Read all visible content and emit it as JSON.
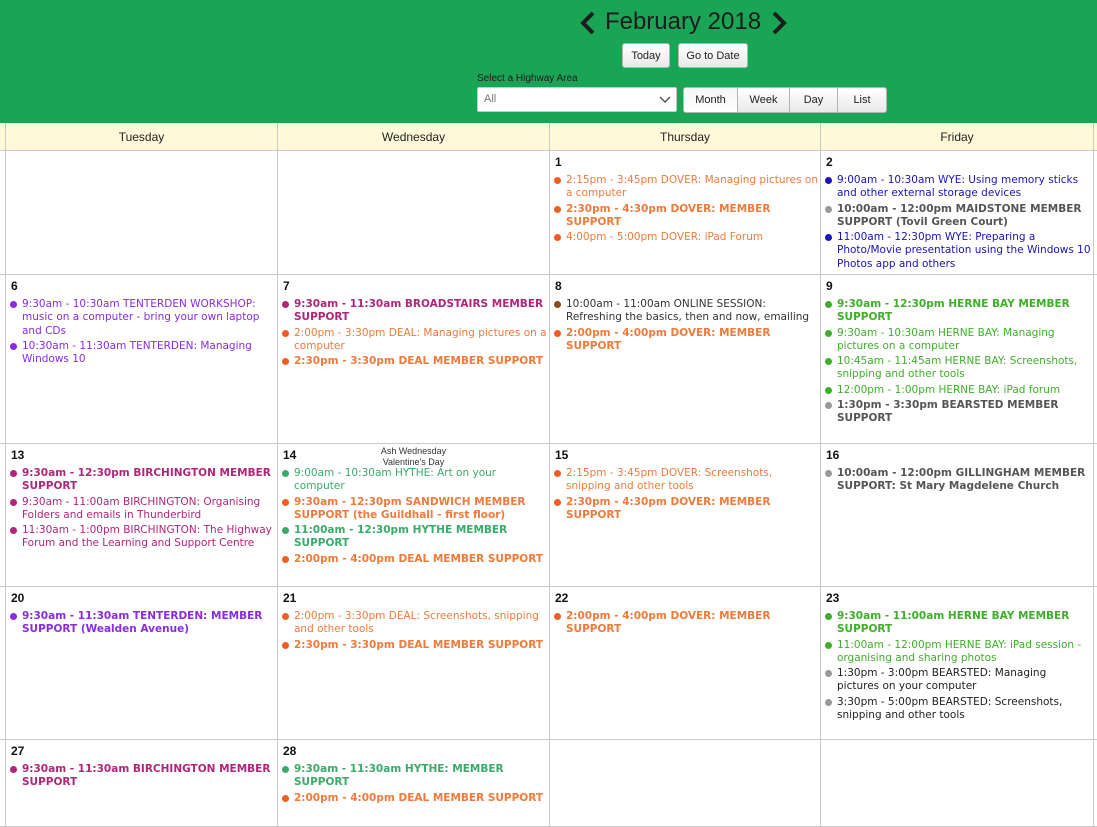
{
  "header": {
    "month_title": "February 2018",
    "today_label": "Today",
    "goto_label": "Go to Date",
    "area_label": "Select a Highway Area",
    "area_value": "All",
    "views": [
      "Month",
      "Week",
      "Day",
      "List"
    ],
    "active_view": "Month"
  },
  "colors": {
    "topbar": "#1aa556",
    "header_row": "#fff9d9",
    "dover": "#ef5d20",
    "wye": "#1a13b8",
    "maidstone": "#999999",
    "tenterden": "#8a2be2",
    "broadstairs": "#b0257a",
    "deal": "#ef5d20",
    "herne_bay": "#3fae2a",
    "bearsted": "#999999",
    "online": "#8a4a1a",
    "hythe": "#3aaa6a",
    "gillingham": "#999999"
  },
  "calendar": {
    "weekdays": [
      "Tuesday",
      "Wednesday",
      "Thursday",
      "Friday"
    ],
    "weeks": [
      {
        "days": [
          {
            "date": "",
            "events": []
          },
          {
            "date": "",
            "events": []
          },
          {
            "date": "1",
            "events": [
              {
                "time": "2:15pm - 3:45pm",
                "text": "DOVER: Managing pictures on a computer",
                "color": "#ef5d20",
                "text_color": "#ef7a3a",
                "bold": false
              },
              {
                "time": "2:30pm - 4:30pm",
                "text": "DOVER: MEMBER SUPPORT",
                "color": "#ef5d20",
                "text_color": "#ef7a3a",
                "bold": true
              },
              {
                "time": "4:00pm - 5:00pm",
                "text": "DOVER: iPad Forum",
                "color": "#ef5d20",
                "text_color": "#ef7a3a",
                "bold": false
              }
            ]
          },
          {
            "date": "2",
            "events": [
              {
                "time": "9:00am - 10:30am",
                "text": "WYE: Using memory sticks and other external storage devices",
                "color": "#1a13b8",
                "text_color": "#1a13b8",
                "bold": false
              },
              {
                "time": "10:00am - 12:00pm",
                "text": "MAIDSTONE MEMBER SUPPORT (Tovil Green Court)",
                "color": "#999999",
                "text_color": "#555555",
                "bold": true
              },
              {
                "time": "11:00am - 12:30pm",
                "text": "WYE: Preparing a Photo/Movie presentation using the Windows 10 Photos app and others",
                "color": "#1a13b8",
                "text_color": "#1a13b8",
                "bold": false
              }
            ]
          }
        ]
      },
      {
        "days": [
          {
            "date": "6",
            "events": [
              {
                "time": "9:30am - 10:30am",
                "text": "TENTERDEN WORKSHOP: music on a computer - bring your own laptop and CDs",
                "color": "#8a2be2",
                "text_color": "#8a2be2",
                "bold": false
              },
              {
                "time": "10:30am - 11:30am",
                "text": "TENTERDEN: Managing Windows 10",
                "color": "#8a2be2",
                "text_color": "#8a2be2",
                "bold": false
              }
            ]
          },
          {
            "date": "7",
            "events": [
              {
                "time": "9:30am - 11:30am",
                "text": "BROADSTAIRS MEMBER SUPPORT",
                "color": "#b0257a",
                "text_color": "#b0257a",
                "bold": true
              },
              {
                "time": "2:00pm - 3:30pm",
                "text": "DEAL: Managing pictures on a computer",
                "color": "#ef5d20",
                "text_color": "#ef7a3a",
                "bold": false
              },
              {
                "time": "2:30pm - 3:30pm",
                "text": "DEAL MEMBER SUPPORT",
                "color": "#ef5d20",
                "text_color": "#ef7a3a",
                "bold": true
              }
            ]
          },
          {
            "date": "8",
            "events": [
              {
                "time": "10:00am - 11:00am",
                "text": "ONLINE SESSION: Refreshing the basics, then and now, emailing",
                "color": "#8a4a1a",
                "text_color": "#333333",
                "bold": false
              },
              {
                "time": "2:00pm - 4:00pm",
                "text": "DOVER: MEMBER SUPPORT",
                "color": "#ef5d20",
                "text_color": "#ef7a3a",
                "bold": true
              }
            ]
          },
          {
            "date": "9",
            "events": [
              {
                "time": "9:30am - 12:30pm",
                "text": "HERNE BAY MEMBER SUPPORT",
                "color": "#3fae2a",
                "text_color": "#3fae2a",
                "bold": true
              },
              {
                "time": "9:30am - 10:30am",
                "text": "HERNE BAY: Managing pictures on a computer",
                "color": "#3fae2a",
                "text_color": "#3fae2a",
                "bold": false
              },
              {
                "time": "10:45am - 11:45am",
                "text": "HERNE BAY: Screenshots, snipping and other tools",
                "color": "#3fae2a",
                "text_color": "#3fae2a",
                "bold": false
              },
              {
                "time": "12:00pm - 1:00pm",
                "text": "HERNE BAY: iPad forum",
                "color": "#3fae2a",
                "text_color": "#3fae2a",
                "bold": false
              },
              {
                "time": "1:30pm - 3:30pm",
                "text": "BEARSTED MEMBER SUPPORT",
                "color": "#999999",
                "text_color": "#555555",
                "bold": true
              }
            ]
          }
        ]
      },
      {
        "days": [
          {
            "date": "13",
            "events": [
              {
                "time": "9:30am - 12:30pm",
                "text": "BIRCHINGTON MEMBER SUPPORT",
                "color": "#b0257a",
                "text_color": "#b0257a",
                "bold": true
              },
              {
                "time": "9:30am - 11:00am",
                "text": "BIRCHINGTON: Organising Folders and emails in Thunderbird",
                "color": "#b0257a",
                "text_color": "#b0257a",
                "bold": false
              },
              {
                "time": "11:30am - 1:00pm",
                "text": "BIRCHINGTON: The Highway Forum and the Learning and Support Centre",
                "color": "#b0257a",
                "text_color": "#b0257a",
                "bold": false
              }
            ]
          },
          {
            "date": "14",
            "holidays": [
              "Ash Wednesday",
              "Valentine's Day"
            ],
            "events": [
              {
                "time": "9:00am - 10:30am",
                "text": "HYTHE: Art on your computer",
                "color": "#3aaa6a",
                "text_color": "#3aaa6a",
                "bold": false
              },
              {
                "time": "9:30am - 12:30pm",
                "text": "SANDWICH MEMBER SUPPORT (the Guildhall - first floor)",
                "color": "#ef5d20",
                "text_color": "#ef7a3a",
                "bold": true
              },
              {
                "time": "11:00am - 12:30pm",
                "text": "HYTHE MEMBER SUPPORT",
                "color": "#3aaa6a",
                "text_color": "#3aaa6a",
                "bold": true
              },
              {
                "time": "2:00pm - 4:00pm",
                "text": "DEAL MEMBER SUPPORT",
                "color": "#ef5d20",
                "text_color": "#ef7a3a",
                "bold": true
              }
            ]
          },
          {
            "date": "15",
            "events": [
              {
                "time": "2:15pm - 3:45pm",
                "text": "DOVER: Screenshots, snipping and other tools",
                "color": "#ef5d20",
                "text_color": "#ef7a3a",
                "bold": false
              },
              {
                "time": "2:30pm - 4:30pm",
                "text": "DOVER: MEMBER SUPPORT",
                "color": "#ef5d20",
                "text_color": "#ef7a3a",
                "bold": true
              }
            ]
          },
          {
            "date": "16",
            "events": [
              {
                "time": "10:00am - 12:00pm",
                "text": "GILLINGHAM MEMBER SUPPORT: St Mary Magdelene Church",
                "color": "#999999",
                "text_color": "#555555",
                "bold": true
              }
            ]
          }
        ]
      },
      {
        "days": [
          {
            "date": "20",
            "events": [
              {
                "time": "9:30am - 11:30am",
                "text": "TENTERDEN: MEMBER SUPPORT (Wealden Avenue)",
                "color": "#8a2be2",
                "text_color": "#8a2be2",
                "bold": true
              }
            ]
          },
          {
            "date": "21",
            "events": [
              {
                "time": "2:00pm - 3:30pm",
                "text": "DEAL: Screenshots, snipping and other tools",
                "color": "#ef5d20",
                "text_color": "#ef7a3a",
                "bold": false
              },
              {
                "time": "2:30pm - 3:30pm",
                "text": "DEAL MEMBER SUPPORT",
                "color": "#ef5d20",
                "text_color": "#ef7a3a",
                "bold": true
              }
            ]
          },
          {
            "date": "22",
            "events": [
              {
                "time": "2:00pm - 4:00pm",
                "text": "DOVER: MEMBER SUPPORT",
                "color": "#ef5d20",
                "text_color": "#ef7a3a",
                "bold": true
              }
            ]
          },
          {
            "date": "23",
            "events": [
              {
                "time": "9:30am - 11:00am",
                "text": "HERNE BAY MEMBER SUPPORT",
                "color": "#3fae2a",
                "text_color": "#3fae2a",
                "bold": true
              },
              {
                "time": "11:00am - 12:00pm",
                "text": "HERNE BAY: iPad session - organising and sharing photos",
                "color": "#3fae2a",
                "text_color": "#3fae2a",
                "bold": false
              },
              {
                "time": "1:30pm - 3:00pm",
                "text": "BEARSTED: Managing pictures on your computer",
                "color": "#999999",
                "text_color": "#222222",
                "bold": false
              },
              {
                "time": "3:30pm - 5:00pm",
                "text": "BEARSTED: Screenshots, snipping and other tools",
                "color": "#999999",
                "text_color": "#222222",
                "bold": false
              }
            ]
          }
        ]
      },
      {
        "days": [
          {
            "date": "27",
            "events": [
              {
                "time": "9:30am - 11:30am",
                "text": "BIRCHINGTON MEMBER SUPPORT",
                "color": "#b0257a",
                "text_color": "#b0257a",
                "bold": true
              }
            ]
          },
          {
            "date": "28",
            "events": [
              {
                "time": "9:30am - 11:30am",
                "text": "HYTHE: MEMBER SUPPORT",
                "color": "#3aaa6a",
                "text_color": "#3aaa6a",
                "bold": true
              },
              {
                "time": "2:00pm - 4:00pm",
                "text": "DEAL MEMBER SUPPORT",
                "color": "#ef5d20",
                "text_color": "#ef7a3a",
                "bold": true
              }
            ]
          },
          {
            "date": "",
            "events": []
          },
          {
            "date": "",
            "events": []
          }
        ]
      }
    ]
  }
}
